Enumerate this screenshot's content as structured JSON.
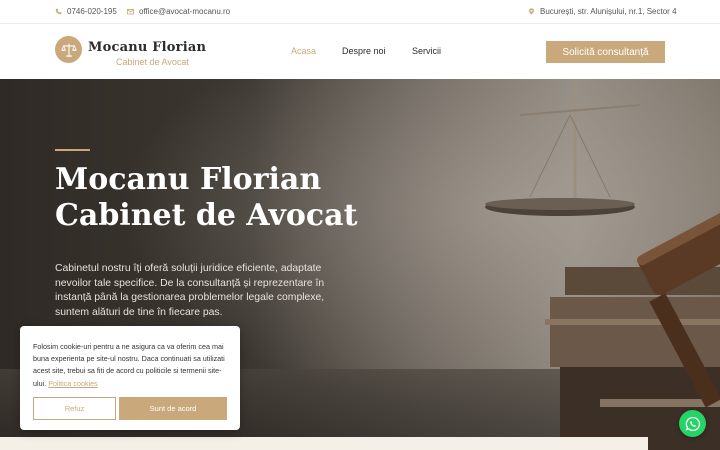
{
  "topbar": {
    "phone": "0746-020-195",
    "email": "office@avocat-mocanu.ro",
    "address": "București, str. Alunișului, nr.1, Sector 4"
  },
  "header": {
    "logo_name": "Mocanu Florian",
    "logo_sub": "Cabinet de Avocat",
    "nav": {
      "home": "Acasa",
      "about": "Despre noi",
      "services": "Servicii"
    },
    "cta": "Solicită consultanță"
  },
  "hero": {
    "title_line1": "Mocanu Florian",
    "title_line2": "Cabinet de Avocat",
    "text": "Cabinetul nostru îți oferă soluții juridice eficiente, adaptate nevoilor tale specifice. De la consultanță și reprezentare în instanță până la gestionarea problemelor legale complexe, suntem alături de tine în fiecare pas."
  },
  "cookie": {
    "text": "Folosim cookie-uri pentru a ne asigura ca va oferim cea mai buna experienta pe site-ul nostru. Daca continuati sa utilizati acest site, trebui sa fiti de acord cu politicile si termenii site-ului.",
    "link": "Politica cookies",
    "refuse": "Refuz",
    "accept": "Sunt de acord"
  },
  "colors": {
    "accent": "#c9a97b",
    "whatsapp": "#25d366"
  },
  "icons": {
    "phone": "phone-icon",
    "email": "mail-icon",
    "address": "location-pin-icon",
    "logo": "scales-of-justice-icon",
    "whatsapp": "whatsapp-icon"
  }
}
